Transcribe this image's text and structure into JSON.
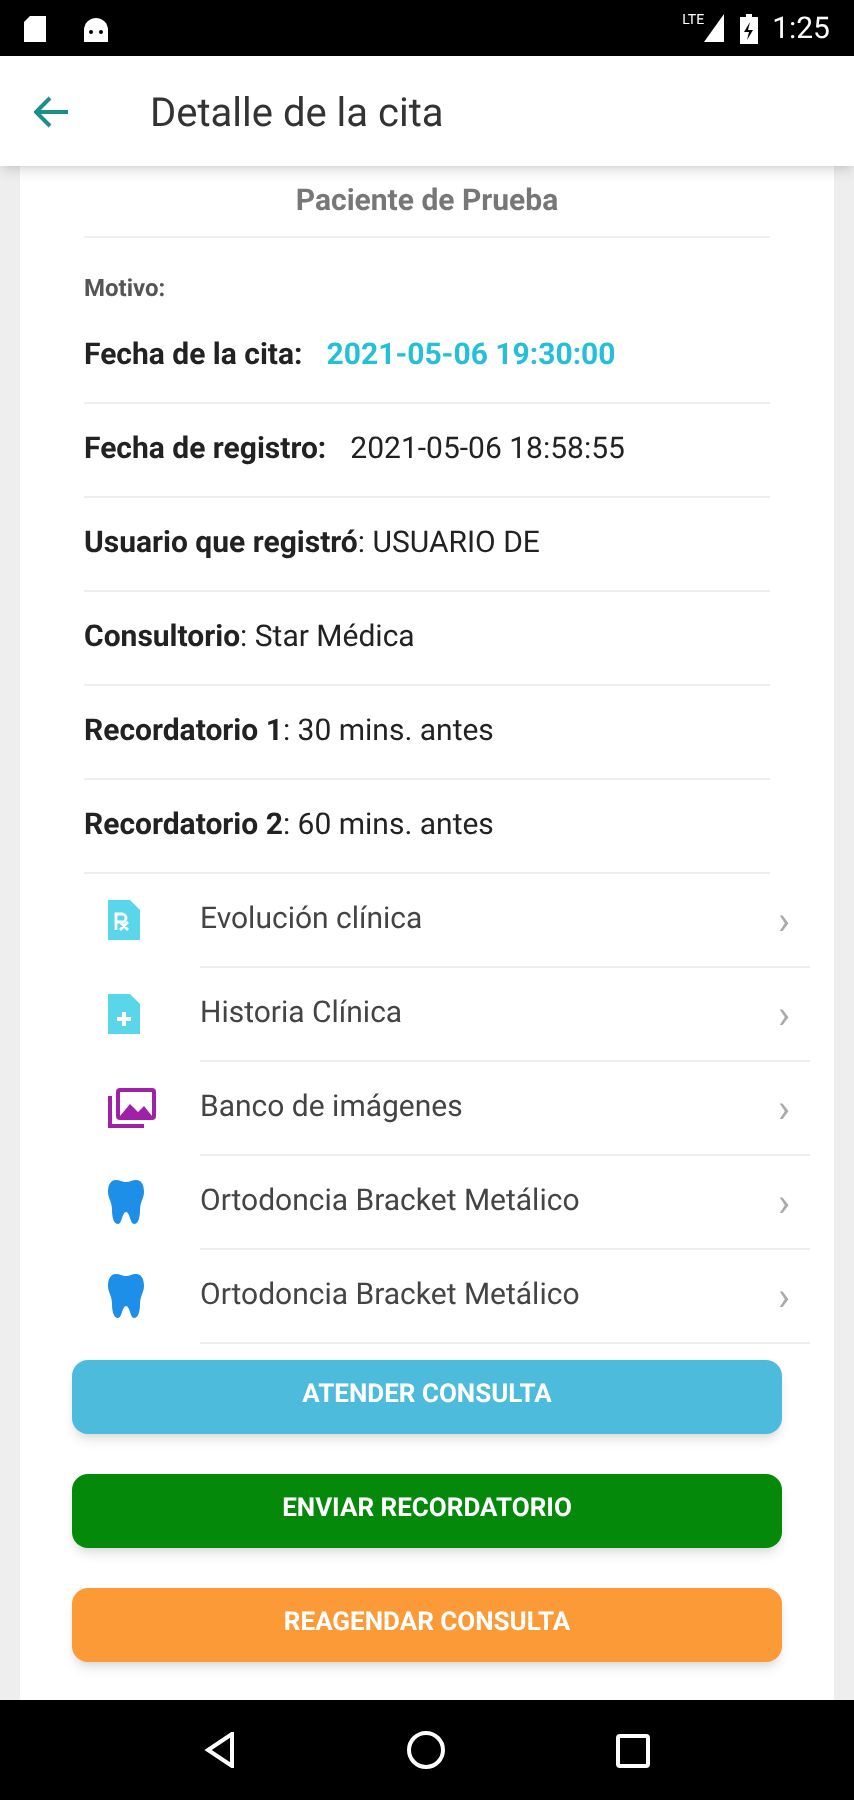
{
  "status_bar": {
    "network": "LTE",
    "time": "1:25"
  },
  "app_bar": {
    "title": "Detalle de la cita"
  },
  "patient": {
    "name": "Paciente de Prueba"
  },
  "reason": {
    "label": "Motivo:"
  },
  "details": [
    {
      "kind": "pair",
      "label": "Fecha de la cita:",
      "value": "2021-05-06 19:30:00",
      "highlight": true
    },
    {
      "kind": "pair",
      "label": "Fecha de registro:",
      "value": "2021-05-06 18:58:55",
      "highlight": false
    },
    {
      "kind": "inline",
      "text": "**Usuario que registró**: USUARIO DE"
    },
    {
      "kind": "inline",
      "text": "**Consultorio**: Star Médica"
    },
    {
      "kind": "inline",
      "text": "**Recordatorio 1**: 30 mins. antes"
    },
    {
      "kind": "inline",
      "text": "**Recordatorio 2**: 60 mins. antes"
    }
  ],
  "menu": [
    {
      "kind": "rx",
      "label": "Evolución clínica",
      "chevron": "›"
    },
    {
      "kind": "doc-plus",
      "label": "Historia Clínica",
      "chevron": "›"
    },
    {
      "kind": "images",
      "label": "Banco de imágenes",
      "chevron": "›"
    },
    {
      "kind": "tooth",
      "label": "Ortodoncia Bracket Metálico",
      "chevron": "›"
    },
    {
      "kind": "tooth",
      "label": "Ortodoncia Bracket Metálico",
      "chevron": "›"
    }
  ],
  "buttons": [
    {
      "label": "ATENDER CONSULTA",
      "color": "#4dbbdc"
    },
    {
      "label": "ENVIAR RECORDATORIO",
      "color": "#05890a"
    },
    {
      "label": "REAGENDAR CONSULTA",
      "color": "#fb9a37"
    }
  ]
}
